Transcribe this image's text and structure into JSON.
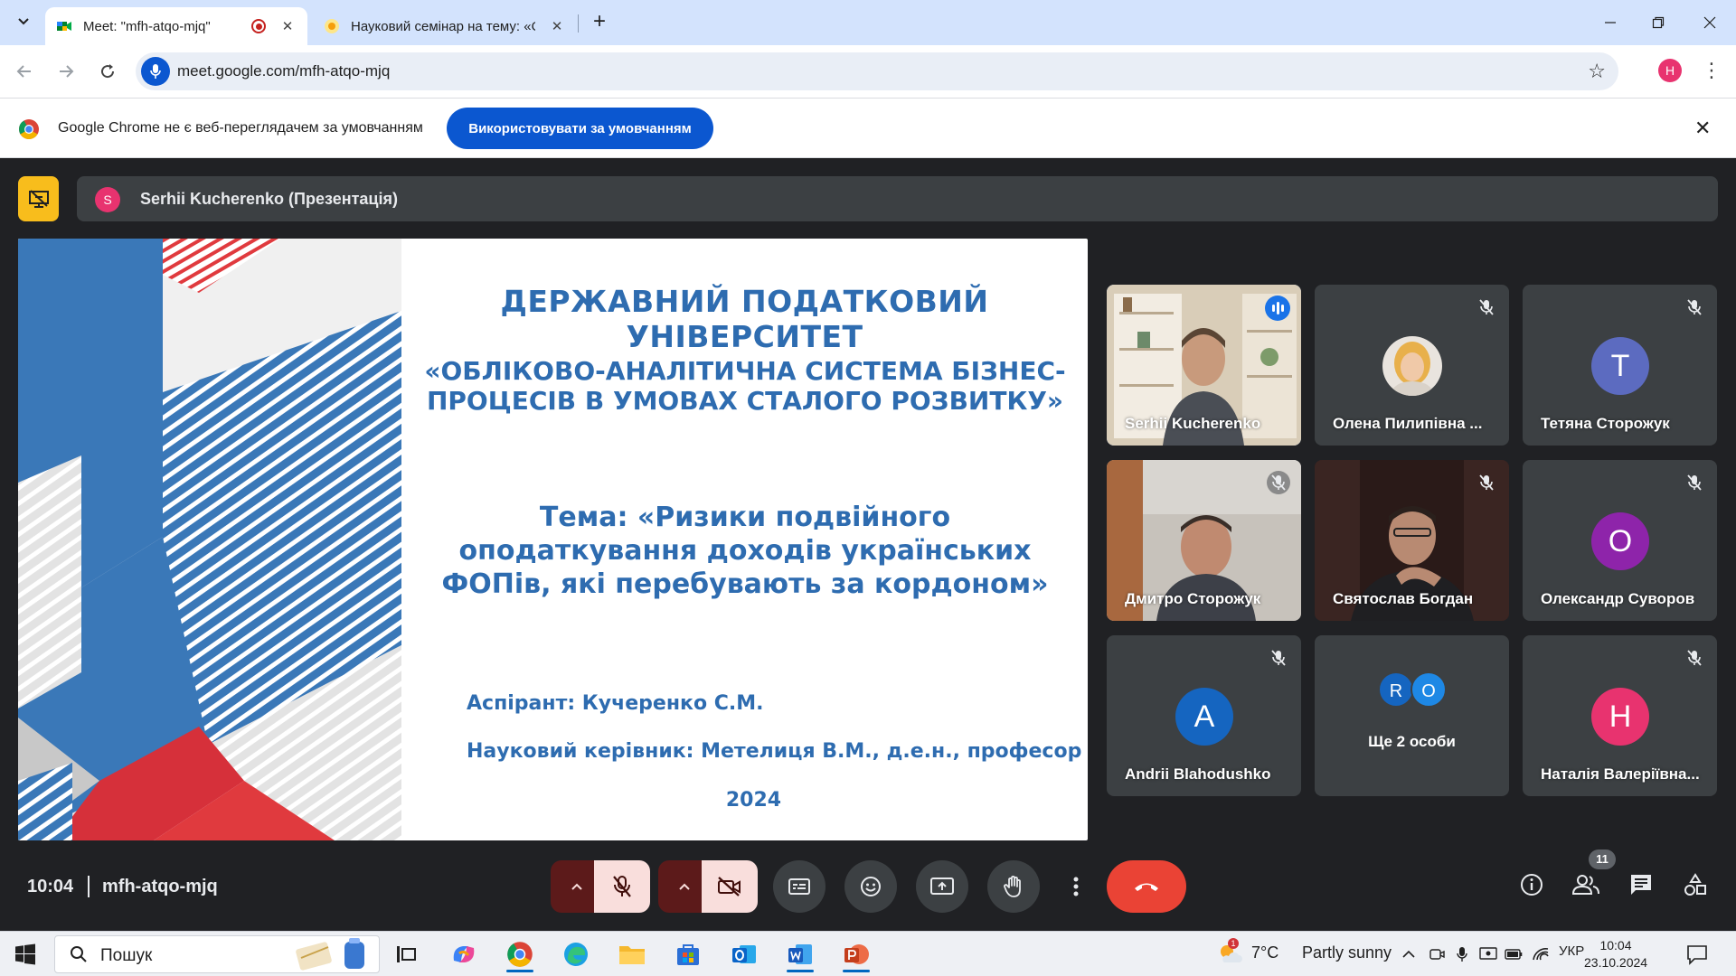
{
  "browser": {
    "tabs": [
      {
        "title": "Meet: \"mfh-atqo-mjq\"",
        "active": true,
        "recording": true
      },
      {
        "title": "Науковий семінар на тему: «О",
        "active": false
      }
    ],
    "url": "meet.google.com/mfh-atqo-mjq",
    "profile_initial": "H",
    "infobar": {
      "message": "Google Chrome не є веб-переглядачем за умовчанням",
      "button": "Використовувати за умовчанням"
    }
  },
  "meet": {
    "presenter": {
      "initial": "S",
      "label": "Serhii Kucherenko (Презентація)"
    },
    "slide": {
      "university": "ДЕРЖАВНИЙ ПОДАТКОВИЙ УНІВЕРСИТЕТ",
      "program_line1": "«ОБЛІКОВО-АНАЛІТИЧНА СИСТЕМА БІЗНЕС-",
      "program_line2": "ПРОЦЕСІВ В УМОВАХ СТАЛОГО РОЗВИТКУ»",
      "topic_line1": "Тема: «Ризики подвійного",
      "topic_line2": "оподаткування доходів  українських",
      "topic_line3": "ФОПів, які перебувають за кордоном»",
      "aspirant": "Аспірант: Кучеренко С.М.",
      "supervisor": "Науковий керівник: Метелиця В.М., д.е.н., професор",
      "year": "2024"
    },
    "participants": [
      {
        "name": "Serhii Kucherenko",
        "type": "video",
        "speaking": true
      },
      {
        "name": "Олена Пилипівна ...",
        "type": "photo",
        "muted": true
      },
      {
        "name": "Тетяна Сторожук",
        "type": "avatar",
        "initial": "T",
        "color": "#5c6bc0",
        "muted": true
      },
      {
        "name": "Дмитро Сторожук",
        "type": "video",
        "muted": true
      },
      {
        "name": "Святослав Богдан",
        "type": "video",
        "muted": true
      },
      {
        "name": "Олександр Суворов",
        "type": "avatar",
        "initial": "O",
        "color": "#8e24aa",
        "muted": true
      },
      {
        "name": "Andrii Blahodushko",
        "type": "avatar",
        "initial": "A",
        "color": "#1565c0",
        "muted": true
      },
      {
        "name": "Ще 2 особи",
        "type": "group",
        "initials": [
          "R",
          "O"
        ]
      },
      {
        "name": "Наталія Валеріївна...",
        "type": "avatar",
        "initial": "H",
        "color": "#e8336f",
        "muted": true
      }
    ],
    "meeting_time": "10:04",
    "meeting_code": "mfh-atqo-mjq",
    "people_count": "11"
  },
  "taskbar": {
    "search_label": "Пошук",
    "weather_temp": "7°C",
    "weather_text": "Partly sunny",
    "weather_badge": "1",
    "language": "УКР",
    "time": "10:04",
    "date": "23.10.2024"
  },
  "colors": {
    "meet_bg": "#202124",
    "tile_bg": "#3c4043",
    "end_call": "#ea4335",
    "chrome_blue": "#0b57d0",
    "slide_text": "#2e6cb0"
  }
}
